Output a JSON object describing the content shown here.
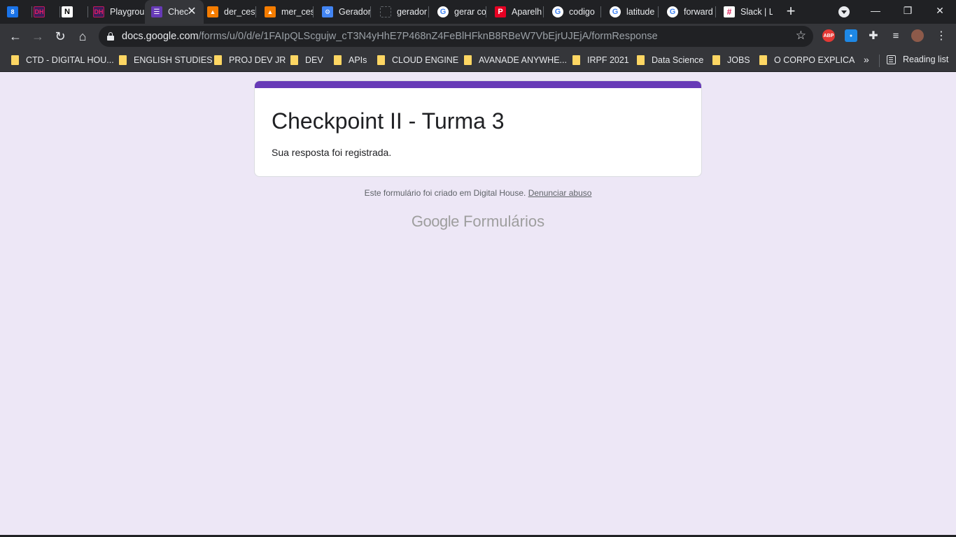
{
  "browser": {
    "tabs": [
      {
        "title": "",
        "favicon": "calendar-icon",
        "color": "#1a73e8"
      },
      {
        "title": "",
        "favicon": "dh-logo-icon",
        "color": "#c2185b"
      },
      {
        "title": "",
        "favicon": "notion-icon",
        "color": "#ffffff"
      },
      {
        "title": "Playgrou",
        "favicon": "dh-logo-icon",
        "color": "#c2185b"
      },
      {
        "title": "Chec",
        "favicon": "forms-icon",
        "color": "#673ab7",
        "active": true
      },
      {
        "title": "der_cest",
        "favicon": "diagram-icon",
        "color": "#f57c00"
      },
      {
        "title": "mer_ces",
        "favicon": "diagram-icon",
        "color": "#f57c00"
      },
      {
        "title": "Gerador",
        "favicon": "gear-icon",
        "color": "#4285f4"
      },
      {
        "title": "gerador",
        "favicon": "dotted-square-icon",
        "color": "#5f6368"
      },
      {
        "title": "gerar co",
        "favicon": "google-icon",
        "color": "#ffffff"
      },
      {
        "title": "Aparelh",
        "favicon": "pinterest-icon",
        "color": "#e60023"
      },
      {
        "title": "codigo",
        "favicon": "google-icon",
        "color": "#ffffff"
      },
      {
        "title": "latitude",
        "favicon": "google-icon",
        "color": "#ffffff"
      },
      {
        "title": "forward",
        "favicon": "google-icon",
        "color": "#ffffff"
      },
      {
        "title": "Slack | L",
        "favicon": "slack-icon",
        "color": "#ffffff"
      }
    ],
    "new_tab": "+",
    "window_controls": {
      "minimize": "—",
      "restore": "❐",
      "close": "✕"
    },
    "url": {
      "host": "docs.google.com",
      "path": "/forms/u/0/d/e/1FAIpQLScgujw_cT3N4yHhE7P468nZ4FeBlHFknB8RBeW7VbEjrUJEjA/formResponse"
    },
    "extensions": [
      {
        "name": "abp-icon",
        "label": "ABP",
        "color": "#e53935"
      },
      {
        "name": "drop-icon",
        "label": "💧",
        "color": "#1e88e5"
      }
    ],
    "bookmarks": [
      "CTD - DIGITAL HOU...",
      "ENGLISH STUDIES",
      "PROJ DEV JR",
      "DEV",
      "APIs",
      "CLOUD ENGINE",
      "AVANADE ANYWHE...",
      "IRPF 2021",
      "Data Science",
      "JOBS",
      "O CORPO EXPLICA"
    ],
    "bookmarks_more": "»",
    "reading_list": "Reading list"
  },
  "form": {
    "title": "Checkpoint II - Turma 3",
    "confirmation": "Sua resposta foi registrada.",
    "accent_color": "#673ab7",
    "background_color": "#ede7f6"
  },
  "footer": {
    "text": "Este formulário foi criado em Digital House.",
    "report_link": "Denunciar abuso"
  },
  "brand": {
    "google": "Google",
    "product": "Formulários"
  }
}
